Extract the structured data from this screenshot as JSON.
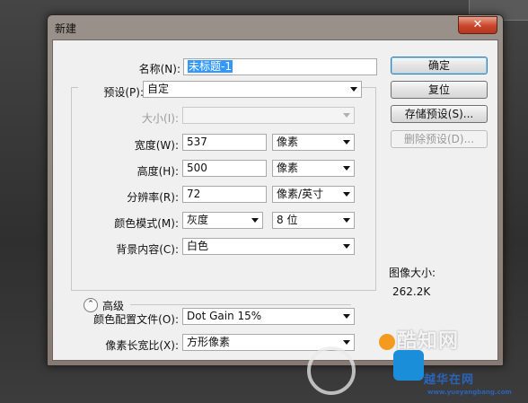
{
  "dialog": {
    "title": "新建",
    "close_glyph": "✕",
    "close_icon": "close-icon"
  },
  "form": {
    "name_label": "名称(N):",
    "name_value": "未标题-1",
    "preset_label": "预设(P):",
    "preset_value": "自定",
    "size_label": "大小(I):",
    "size_value": "",
    "width_label": "宽度(W):",
    "width_value": "537",
    "width_unit": "像素",
    "height_label": "高度(H):",
    "height_value": "500",
    "height_unit": "像素",
    "resolution_label": "分辨率(R):",
    "resolution_value": "72",
    "resolution_unit": "像素/英寸",
    "color_mode_label": "颜色模式(M):",
    "color_mode_value": "灰度",
    "bit_depth_value": "8 位",
    "bg_content_label": "背景内容(C):",
    "bg_content_value": "白色",
    "advanced_label": "高级",
    "advanced_toggle_icon": "collapse-up-icon",
    "color_profile_label": "颜色配置文件(O):",
    "color_profile_value": "Dot Gain 15%",
    "pixel_aspect_label": "像素长宽比(X):",
    "pixel_aspect_value": "方形像素"
  },
  "buttons": {
    "ok": "确定",
    "reset": "复位",
    "save_preset": "存储预设(S)...",
    "delete_preset": "删除预设(D)..."
  },
  "image_size": {
    "title": "图像大小:",
    "value": "262.2K"
  },
  "watermark": {
    "brand_cn": "酷知网",
    "site_cn": "越华在网",
    "url": "www.yueyangbang.com"
  },
  "colors": {
    "accent": "#3399ff",
    "default_button_border": "#3c7fb1",
    "close_button": "#c9452b",
    "watermark_blue": "#2a63b8"
  }
}
